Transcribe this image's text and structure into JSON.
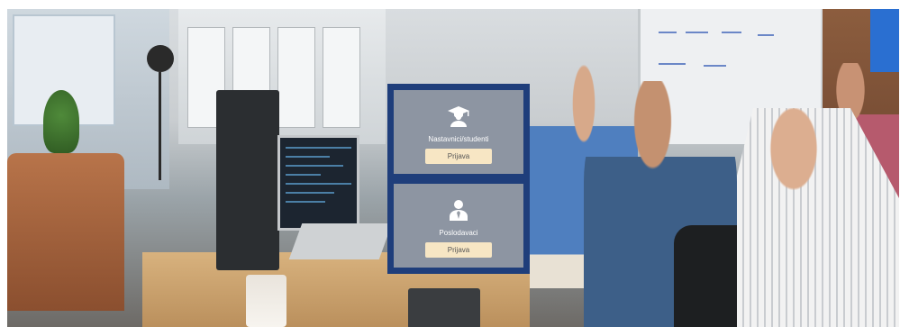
{
  "login_panel": {
    "roles": [
      {
        "title": "Nastavnici/studenti",
        "button_label": "Prijava",
        "icon": "graduate-icon"
      },
      {
        "title": "Poslodavaci",
        "button_label": "Prijava",
        "icon": "employer-icon"
      }
    ]
  },
  "colors": {
    "panel_border": "#1f3e7b",
    "card_background": "#969ca5",
    "button_background": "#f7e6c4"
  }
}
